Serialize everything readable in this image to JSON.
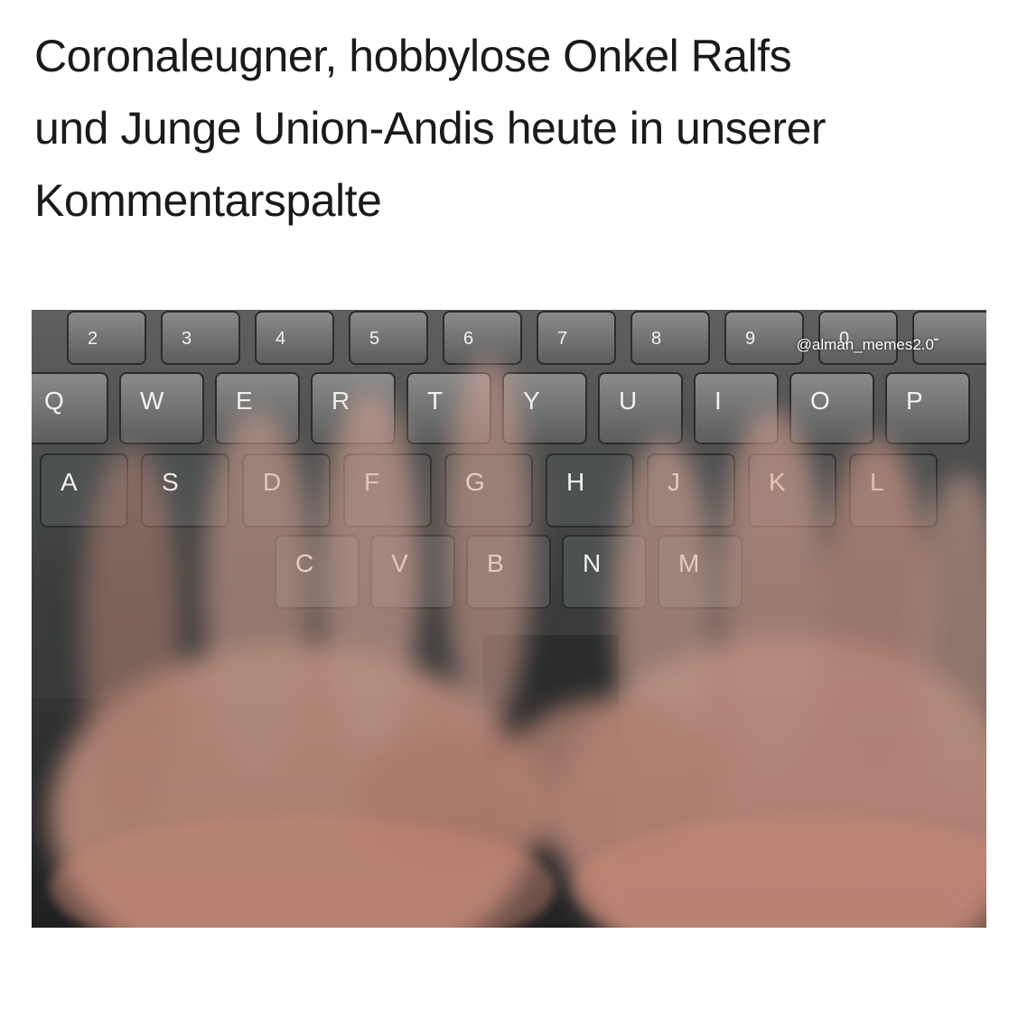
{
  "caption": {
    "lines": [
      "Coronaleugner, hobbylose Onkel Ralfs",
      "und Junge Union-Andis heute in unserer",
      "Kommentarspalte"
    ]
  },
  "photo": {
    "watermark": "@alman_memes2.0",
    "key_rows": [
      [
        "2",
        "3",
        "4",
        "5",
        "6",
        "7",
        "8",
        "9",
        "0",
        "-"
      ],
      [
        "Q",
        "W",
        "E",
        "R",
        "T",
        "Y",
        "U",
        "I",
        "O",
        "P"
      ],
      [
        "A",
        "S",
        "D",
        "F",
        "G",
        "H",
        "J",
        "K",
        "L"
      ],
      [
        "C",
        "V",
        "B",
        "N",
        "M"
      ]
    ]
  }
}
